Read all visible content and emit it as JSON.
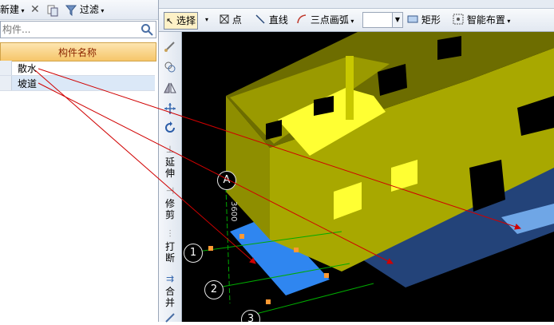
{
  "left_toolbar": {
    "new_label": "新建",
    "filter_label": "过滤"
  },
  "search": {
    "placeholder": "构件..."
  },
  "table": {
    "header": "构件名称",
    "rows": [
      {
        "name": "散水"
      },
      {
        "name": "坡道"
      }
    ]
  },
  "top_toolbar": {
    "select_label": "选择",
    "point_label": "点",
    "line_label": "直线",
    "arc_label": "三点画弧",
    "rect_label": "矩形",
    "smart_label": "智能布置"
  },
  "tool_strip": {
    "extend_label": "延伸",
    "trim_label": "修剪",
    "break_label": "打断",
    "merge_label": "合并"
  },
  "viewport": {
    "axis_labels": [
      "A",
      "1",
      "2",
      "3"
    ],
    "dimension_text": "3600"
  },
  "colors": {
    "wall": "#a8a800",
    "wall_top": "#c8c800",
    "window": "#ffff33",
    "slab": "#3f87e0",
    "annotation_arrow": "#d00000"
  }
}
